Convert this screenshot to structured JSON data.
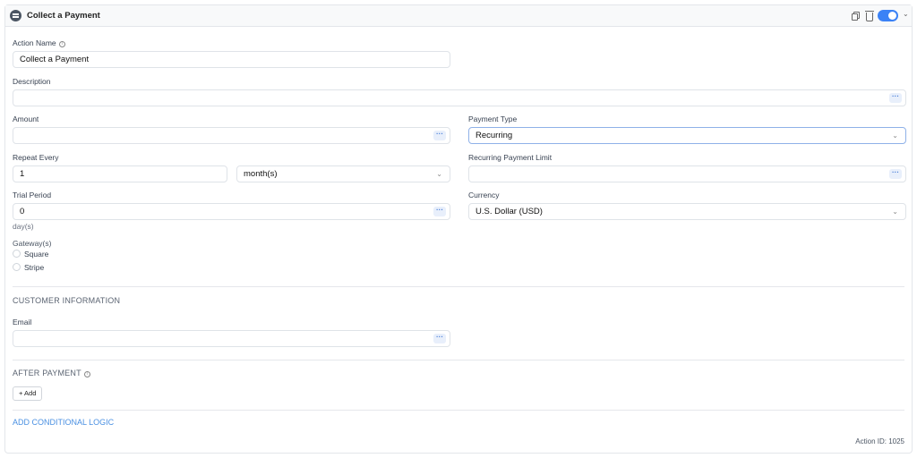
{
  "header": {
    "title": "Collect a Payment",
    "icons": [
      "copy-icon",
      "trash-icon",
      "toggle-switch",
      "chevron-down-icon"
    ],
    "enabled": true
  },
  "fields": {
    "action_name": {
      "label": "Action Name",
      "value": "Collect a Payment"
    },
    "description": {
      "label": "Description",
      "value": ""
    },
    "amount": {
      "label": "Amount",
      "value": ""
    },
    "payment_type": {
      "label": "Payment Type",
      "value": "Recurring"
    },
    "repeat_every": {
      "label": "Repeat Every",
      "value": "1",
      "unit": "month(s)"
    },
    "recurring_limit": {
      "label": "Recurring Payment Limit",
      "value": ""
    },
    "trial_period": {
      "label": "Trial Period",
      "value": "0",
      "hint": "day(s)"
    },
    "currency": {
      "label": "Currency",
      "value": "U.S. Dollar (USD)"
    },
    "gateways": {
      "label": "Gateway(s)",
      "options": [
        "Square",
        "Stripe"
      ]
    }
  },
  "customer": {
    "title": "CUSTOMER INFORMATION",
    "email_label": "Email",
    "email_value": ""
  },
  "after_payment": {
    "title": "AFTER PAYMENT",
    "add_label": "+ Add"
  },
  "conditional_link": "ADD CONDITIONAL LOGIC",
  "footer": {
    "action_id": "Action ID: 1025"
  },
  "colors": {
    "accent": "#3b82f6",
    "link": "#4a90e2"
  }
}
